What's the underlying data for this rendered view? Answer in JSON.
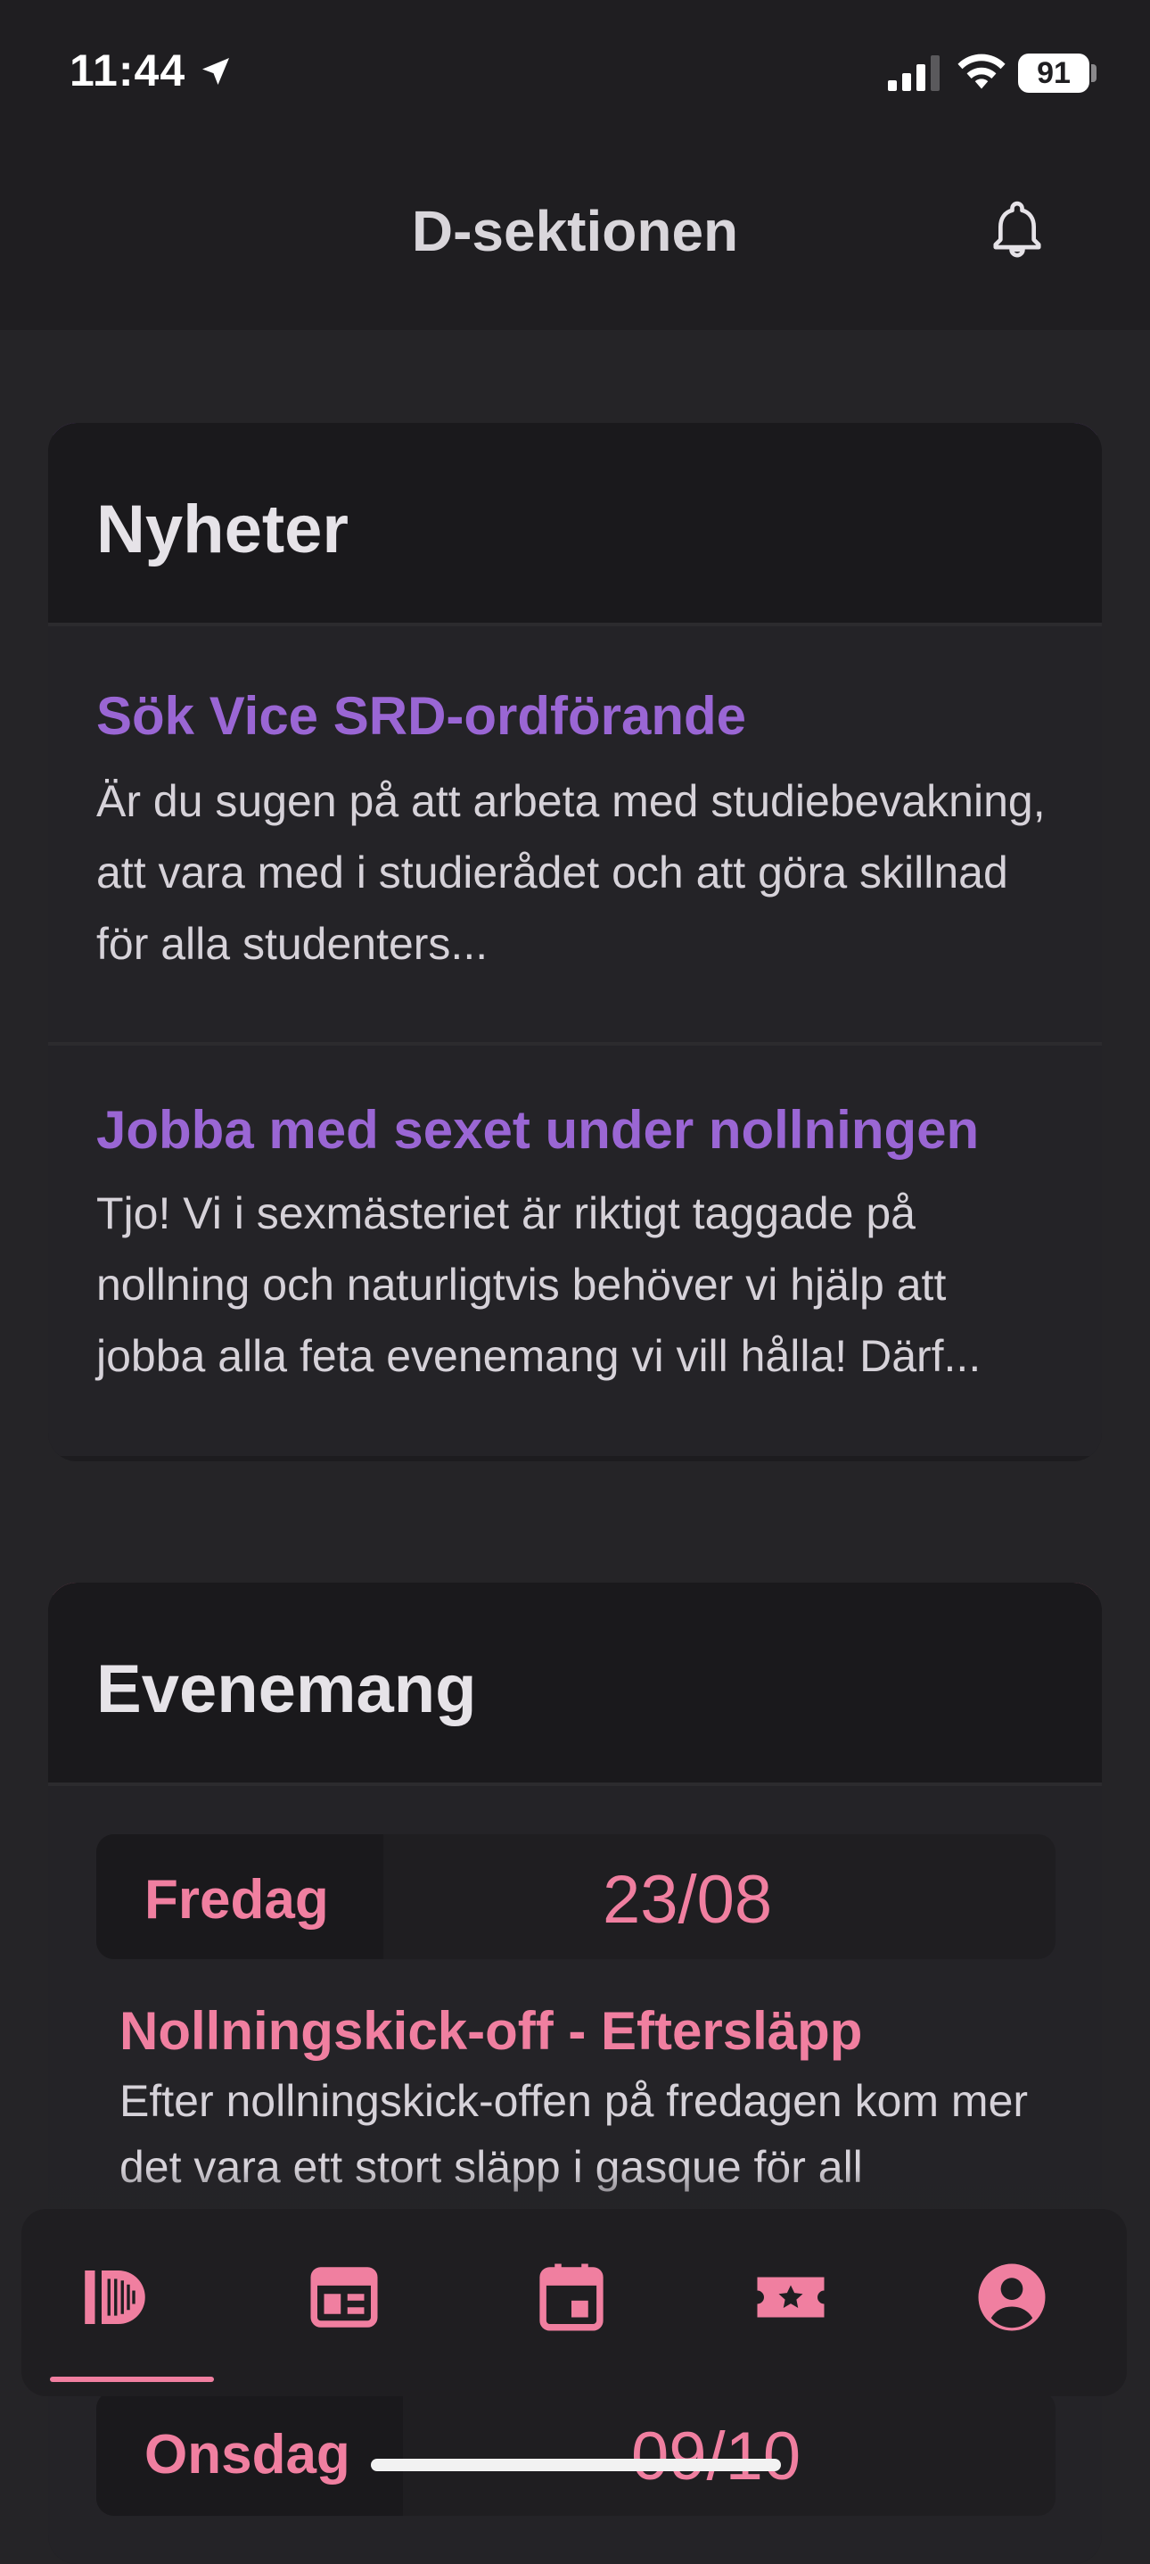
{
  "status": {
    "time": "11:44",
    "battery": "91"
  },
  "header": {
    "title": "D-sektionen"
  },
  "news": {
    "heading": "Nyheter",
    "accent_color": "#9a66d4",
    "items": [
      {
        "title": "Sök Vice SRD-ordförande",
        "body": "Är du sugen på att arbeta med studiebevakning, att vara med i studierådet och att göra skillnad för alla studenters..."
      },
      {
        "title": "Jobba med sexet under nollningen",
        "body": "Tjo! Vi i sexmästeriet är riktigt taggade på nollning och naturligtvis behöver vi hjälp att jobba alla feta evenemang vi vill hålla! Därf..."
      }
    ]
  },
  "events": {
    "heading": "Evenemang",
    "accent_color": "#f07fa0",
    "items": [
      {
        "day": "Fredag",
        "date": "23/08",
        "title": "Nollningskick-off - Eftersläpp",
        "description": "Efter nollningskick-offen på fredagen kom mer det vara ett stort släpp i gasque för all"
      },
      {
        "day": "Onsdag",
        "date": "09/10"
      }
    ]
  },
  "nav": {
    "items": [
      {
        "icon": "d-logo-icon"
      },
      {
        "icon": "newspaper-icon"
      },
      {
        "icon": "calendar-icon"
      },
      {
        "icon": "ticket-star-icon"
      },
      {
        "icon": "account-icon"
      }
    ],
    "active_index": 0
  }
}
